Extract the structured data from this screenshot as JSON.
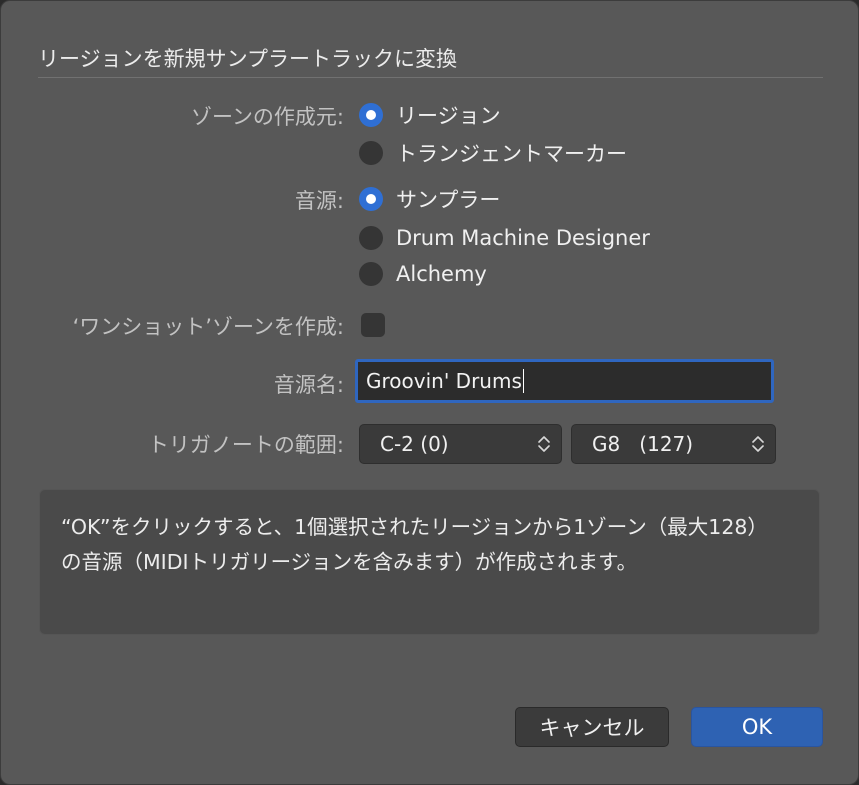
{
  "dialog": {
    "title": "リージョンを新規サンプラートラックに変換"
  },
  "zone_source": {
    "label": "ゾーンの作成元:",
    "options": [
      {
        "label": "リージョン",
        "selected": true
      },
      {
        "label": "トランジェントマーカー",
        "selected": false
      }
    ]
  },
  "instrument": {
    "label": "音源:",
    "options": [
      {
        "label": "サンプラー",
        "selected": true
      },
      {
        "label": "Drum Machine Designer",
        "selected": false
      },
      {
        "label": "Alchemy",
        "selected": false
      }
    ]
  },
  "one_shot": {
    "label": "‘ワンショット’ゾーンを作成:",
    "checked": false
  },
  "instrument_name": {
    "label": "音源名:",
    "value": "Groovin' Drums"
  },
  "trigger_range": {
    "label": "トリガノートの範囲:",
    "low": "C-2 (0)",
    "high": "G8   (127)"
  },
  "info_text": "“OK”をクリックすると、1個選択されたリージョンから1ゾーン（最大128）の音源（MIDIトリガリージョンを含みます）が作成されます。",
  "buttons": {
    "cancel": "キャンセル",
    "ok": "OK"
  },
  "colors": {
    "dialog_bg": "#585858",
    "accent": "#2e62b3",
    "control_bg": "#353535"
  }
}
